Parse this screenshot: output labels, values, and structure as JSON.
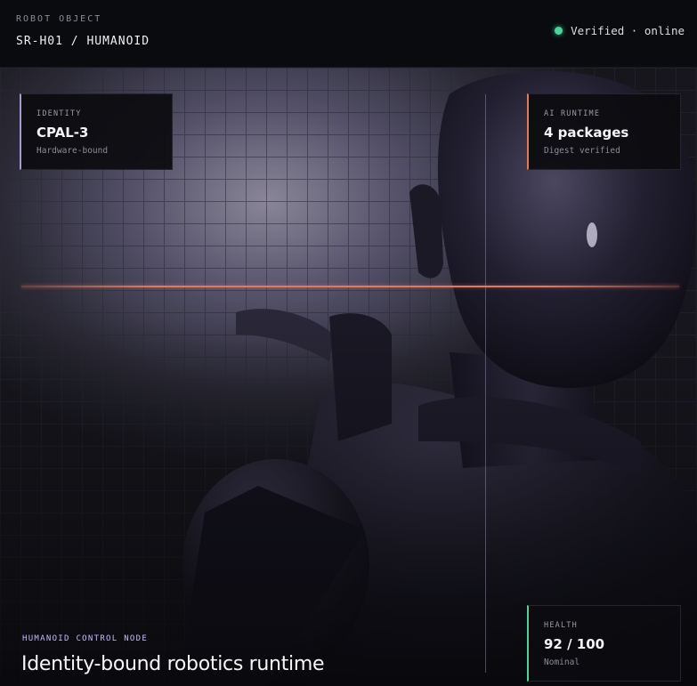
{
  "header": {
    "kicker": "ROBOT OBJECT",
    "title": "SR-H01 / HUMANOID",
    "status_text": "Verified · online",
    "status_color": "#4fd39b"
  },
  "cards": {
    "identity": {
      "label": "IDENTITY",
      "value": "CPAL-3",
      "sub": "Hardware-bound",
      "accent": "#a995e0"
    },
    "runtime": {
      "label": "AI RUNTIME",
      "value": "4 packages",
      "sub": "Digest verified",
      "accent": "#e2785c"
    },
    "health": {
      "label": "HEALTH",
      "value": "92 / 100",
      "sub": "Nominal",
      "accent": "#4fd39b"
    }
  },
  "caption": {
    "kicker": "HUMANOID CONTROL NODE",
    "title": "Identity-bound robotics runtime"
  },
  "hero": {
    "image_subject": "humanoid-robot-image",
    "scan_line_color": "#e2785c"
  }
}
